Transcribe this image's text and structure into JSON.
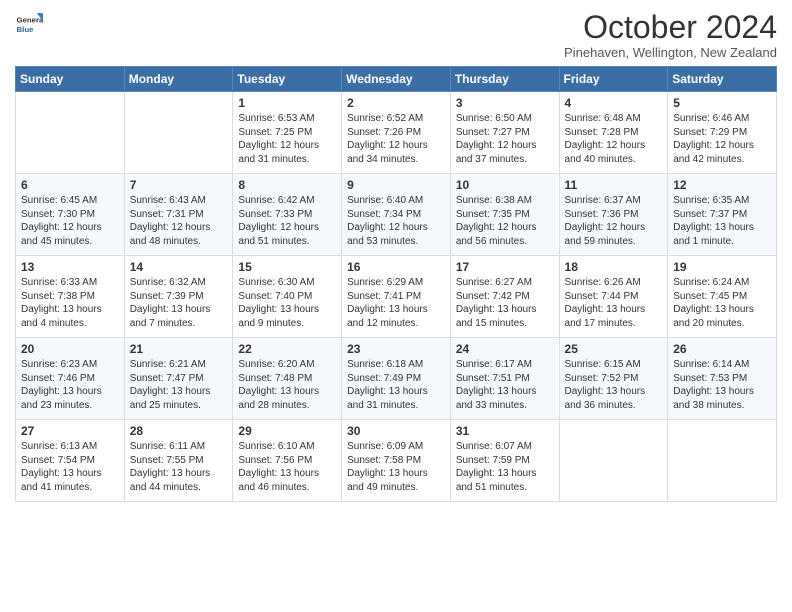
{
  "header": {
    "logo_general": "General",
    "logo_blue": "Blue",
    "month_title": "October 2024",
    "location": "Pinehaven, Wellington, New Zealand"
  },
  "days_of_week": [
    "Sunday",
    "Monday",
    "Tuesday",
    "Wednesday",
    "Thursday",
    "Friday",
    "Saturday"
  ],
  "weeks": [
    [
      {
        "day": "",
        "info": ""
      },
      {
        "day": "",
        "info": ""
      },
      {
        "day": "1",
        "info": "Sunrise: 6:53 AM\nSunset: 7:25 PM\nDaylight: 12 hours and 31 minutes."
      },
      {
        "day": "2",
        "info": "Sunrise: 6:52 AM\nSunset: 7:26 PM\nDaylight: 12 hours and 34 minutes."
      },
      {
        "day": "3",
        "info": "Sunrise: 6:50 AM\nSunset: 7:27 PM\nDaylight: 12 hours and 37 minutes."
      },
      {
        "day": "4",
        "info": "Sunrise: 6:48 AM\nSunset: 7:28 PM\nDaylight: 12 hours and 40 minutes."
      },
      {
        "day": "5",
        "info": "Sunrise: 6:46 AM\nSunset: 7:29 PM\nDaylight: 12 hours and 42 minutes."
      }
    ],
    [
      {
        "day": "6",
        "info": "Sunrise: 6:45 AM\nSunset: 7:30 PM\nDaylight: 12 hours and 45 minutes."
      },
      {
        "day": "7",
        "info": "Sunrise: 6:43 AM\nSunset: 7:31 PM\nDaylight: 12 hours and 48 minutes."
      },
      {
        "day": "8",
        "info": "Sunrise: 6:42 AM\nSunset: 7:33 PM\nDaylight: 12 hours and 51 minutes."
      },
      {
        "day": "9",
        "info": "Sunrise: 6:40 AM\nSunset: 7:34 PM\nDaylight: 12 hours and 53 minutes."
      },
      {
        "day": "10",
        "info": "Sunrise: 6:38 AM\nSunset: 7:35 PM\nDaylight: 12 hours and 56 minutes."
      },
      {
        "day": "11",
        "info": "Sunrise: 6:37 AM\nSunset: 7:36 PM\nDaylight: 12 hours and 59 minutes."
      },
      {
        "day": "12",
        "info": "Sunrise: 6:35 AM\nSunset: 7:37 PM\nDaylight: 13 hours and 1 minute."
      }
    ],
    [
      {
        "day": "13",
        "info": "Sunrise: 6:33 AM\nSunset: 7:38 PM\nDaylight: 13 hours and 4 minutes."
      },
      {
        "day": "14",
        "info": "Sunrise: 6:32 AM\nSunset: 7:39 PM\nDaylight: 13 hours and 7 minutes."
      },
      {
        "day": "15",
        "info": "Sunrise: 6:30 AM\nSunset: 7:40 PM\nDaylight: 13 hours and 9 minutes."
      },
      {
        "day": "16",
        "info": "Sunrise: 6:29 AM\nSunset: 7:41 PM\nDaylight: 13 hours and 12 minutes."
      },
      {
        "day": "17",
        "info": "Sunrise: 6:27 AM\nSunset: 7:42 PM\nDaylight: 13 hours and 15 minutes."
      },
      {
        "day": "18",
        "info": "Sunrise: 6:26 AM\nSunset: 7:44 PM\nDaylight: 13 hours and 17 minutes."
      },
      {
        "day": "19",
        "info": "Sunrise: 6:24 AM\nSunset: 7:45 PM\nDaylight: 13 hours and 20 minutes."
      }
    ],
    [
      {
        "day": "20",
        "info": "Sunrise: 6:23 AM\nSunset: 7:46 PM\nDaylight: 13 hours and 23 minutes."
      },
      {
        "day": "21",
        "info": "Sunrise: 6:21 AM\nSunset: 7:47 PM\nDaylight: 13 hours and 25 minutes."
      },
      {
        "day": "22",
        "info": "Sunrise: 6:20 AM\nSunset: 7:48 PM\nDaylight: 13 hours and 28 minutes."
      },
      {
        "day": "23",
        "info": "Sunrise: 6:18 AM\nSunset: 7:49 PM\nDaylight: 13 hours and 31 minutes."
      },
      {
        "day": "24",
        "info": "Sunrise: 6:17 AM\nSunset: 7:51 PM\nDaylight: 13 hours and 33 minutes."
      },
      {
        "day": "25",
        "info": "Sunrise: 6:15 AM\nSunset: 7:52 PM\nDaylight: 13 hours and 36 minutes."
      },
      {
        "day": "26",
        "info": "Sunrise: 6:14 AM\nSunset: 7:53 PM\nDaylight: 13 hours and 38 minutes."
      }
    ],
    [
      {
        "day": "27",
        "info": "Sunrise: 6:13 AM\nSunset: 7:54 PM\nDaylight: 13 hours and 41 minutes."
      },
      {
        "day": "28",
        "info": "Sunrise: 6:11 AM\nSunset: 7:55 PM\nDaylight: 13 hours and 44 minutes."
      },
      {
        "day": "29",
        "info": "Sunrise: 6:10 AM\nSunset: 7:56 PM\nDaylight: 13 hours and 46 minutes."
      },
      {
        "day": "30",
        "info": "Sunrise: 6:09 AM\nSunset: 7:58 PM\nDaylight: 13 hours and 49 minutes."
      },
      {
        "day": "31",
        "info": "Sunrise: 6:07 AM\nSunset: 7:59 PM\nDaylight: 13 hours and 51 minutes."
      },
      {
        "day": "",
        "info": ""
      },
      {
        "day": "",
        "info": ""
      }
    ]
  ]
}
